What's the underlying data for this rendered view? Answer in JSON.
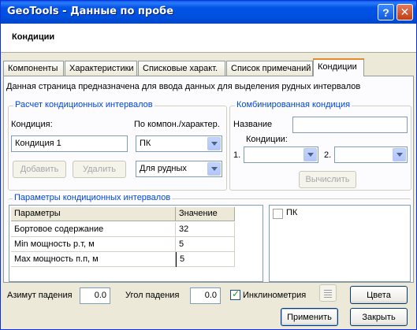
{
  "window": {
    "title": "GeoTools - Данные по пробе",
    "help_glyph": "?",
    "close_glyph": "✕"
  },
  "header": {
    "title": "Кондиции"
  },
  "tabs": [
    {
      "label": "Компоненты"
    },
    {
      "label": "Характеристики"
    },
    {
      "label": "Списковые характ."
    },
    {
      "label": "Список примечаний"
    },
    {
      "label": "Кондиции",
      "active": true
    }
  ],
  "description": "Данная страница предназначена для ввода данных для выделения рудных интервалов",
  "calc_group": {
    "title": "Расчет кондиционных интервалов",
    "condition_label": "Кондиция:",
    "by_label": "По компон./характер.",
    "condition_value": "Кондиция 1",
    "component_value": "ПК",
    "ore_type_value": "Для рудных",
    "add_button": "Добавить",
    "delete_button": "Удалить"
  },
  "combined_group": {
    "title": "Комбинированная кондиция",
    "name_label": "Название",
    "name_value": "",
    "conditions_label": "Кондиции:",
    "first_label": "1.",
    "second_label": "2.",
    "first_value": "",
    "second_value": "",
    "compute_button": "Вычислить"
  },
  "params_group": {
    "title": "Параметры кондиционных интервалов",
    "columns": [
      "Параметры",
      "Значение"
    ],
    "rows": [
      {
        "param": "Бортовое содержание",
        "value": "32"
      },
      {
        "param": "Min мощность р.т, м",
        "value": "5"
      },
      {
        "param": "Max мощность п.п, м",
        "value": "5"
      }
    ],
    "list_items": [
      {
        "label": "ПК",
        "checked": false
      }
    ]
  },
  "bottom": {
    "azimuth_label": "Азимут падения",
    "azimuth_value": "0.0",
    "angle_label": "Угол падения",
    "angle_value": "0.0",
    "inclinometry_label": "Инклинометрия",
    "inclinometry_checked": true,
    "colors_button": "Цвета",
    "apply_button": "Применить",
    "close_button": "Закрыть"
  }
}
